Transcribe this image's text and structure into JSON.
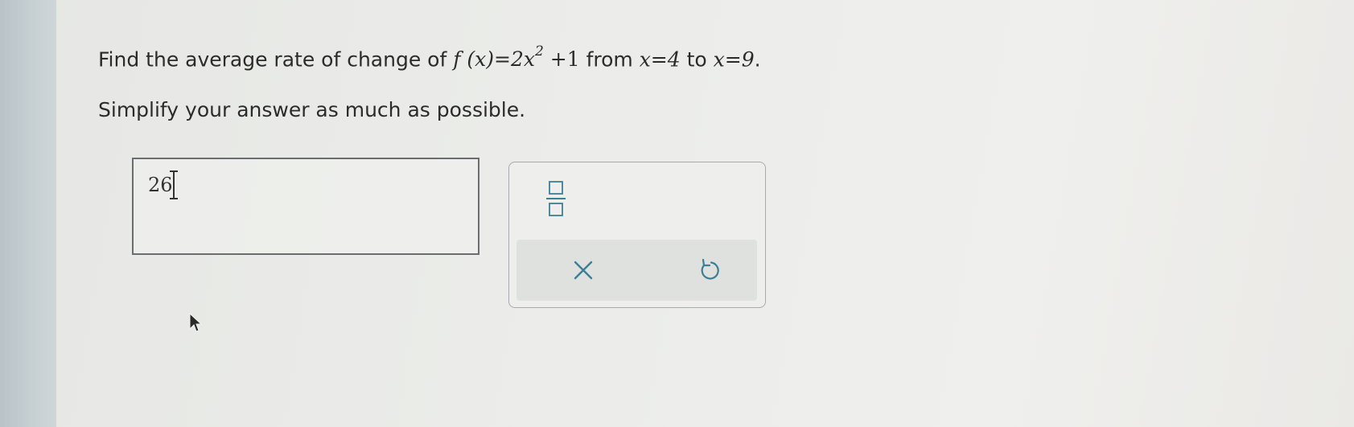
{
  "question": {
    "prefix": "Find the average rate of change of ",
    "function_lhs": "f (x)",
    "eq1": "=",
    "function_rhs_base": "2x",
    "exponent": "2",
    "function_rhs_tail": " +1",
    "from_word": " from ",
    "x_start": "x=4",
    "to_word": " to ",
    "x_end": "x=9",
    "end_punct": "."
  },
  "instruction": "Simplify your answer as much as possible.",
  "answer": {
    "value": "26"
  },
  "palette": {
    "fraction_icon": "fraction-template-icon",
    "clear_icon": "close-icon",
    "undo_icon": "undo-icon",
    "icon_color": "#3b7f96"
  }
}
